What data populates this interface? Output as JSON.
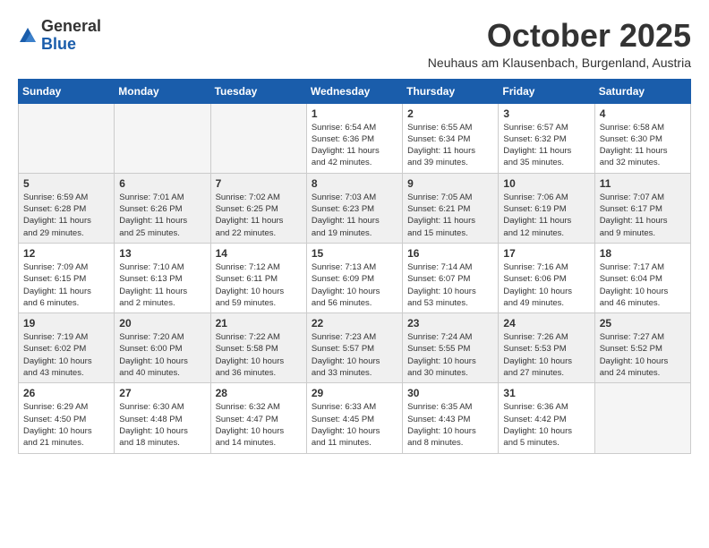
{
  "logo": {
    "general": "General",
    "blue": "Blue"
  },
  "header": {
    "month": "October 2025",
    "location": "Neuhaus am Klausenbach, Burgenland, Austria"
  },
  "weekdays": [
    "Sunday",
    "Monday",
    "Tuesday",
    "Wednesday",
    "Thursday",
    "Friday",
    "Saturday"
  ],
  "weeks": [
    [
      {
        "day": "",
        "info": ""
      },
      {
        "day": "",
        "info": ""
      },
      {
        "day": "",
        "info": ""
      },
      {
        "day": "1",
        "info": "Sunrise: 6:54 AM\nSunset: 6:36 PM\nDaylight: 11 hours\nand 42 minutes."
      },
      {
        "day": "2",
        "info": "Sunrise: 6:55 AM\nSunset: 6:34 PM\nDaylight: 11 hours\nand 39 minutes."
      },
      {
        "day": "3",
        "info": "Sunrise: 6:57 AM\nSunset: 6:32 PM\nDaylight: 11 hours\nand 35 minutes."
      },
      {
        "day": "4",
        "info": "Sunrise: 6:58 AM\nSunset: 6:30 PM\nDaylight: 11 hours\nand 32 minutes."
      }
    ],
    [
      {
        "day": "5",
        "info": "Sunrise: 6:59 AM\nSunset: 6:28 PM\nDaylight: 11 hours\nand 29 minutes."
      },
      {
        "day": "6",
        "info": "Sunrise: 7:01 AM\nSunset: 6:26 PM\nDaylight: 11 hours\nand 25 minutes."
      },
      {
        "day": "7",
        "info": "Sunrise: 7:02 AM\nSunset: 6:25 PM\nDaylight: 11 hours\nand 22 minutes."
      },
      {
        "day": "8",
        "info": "Sunrise: 7:03 AM\nSunset: 6:23 PM\nDaylight: 11 hours\nand 19 minutes."
      },
      {
        "day": "9",
        "info": "Sunrise: 7:05 AM\nSunset: 6:21 PM\nDaylight: 11 hours\nand 15 minutes."
      },
      {
        "day": "10",
        "info": "Sunrise: 7:06 AM\nSunset: 6:19 PM\nDaylight: 11 hours\nand 12 minutes."
      },
      {
        "day": "11",
        "info": "Sunrise: 7:07 AM\nSunset: 6:17 PM\nDaylight: 11 hours\nand 9 minutes."
      }
    ],
    [
      {
        "day": "12",
        "info": "Sunrise: 7:09 AM\nSunset: 6:15 PM\nDaylight: 11 hours\nand 6 minutes."
      },
      {
        "day": "13",
        "info": "Sunrise: 7:10 AM\nSunset: 6:13 PM\nDaylight: 11 hours\nand 2 minutes."
      },
      {
        "day": "14",
        "info": "Sunrise: 7:12 AM\nSunset: 6:11 PM\nDaylight: 10 hours\nand 59 minutes."
      },
      {
        "day": "15",
        "info": "Sunrise: 7:13 AM\nSunset: 6:09 PM\nDaylight: 10 hours\nand 56 minutes."
      },
      {
        "day": "16",
        "info": "Sunrise: 7:14 AM\nSunset: 6:07 PM\nDaylight: 10 hours\nand 53 minutes."
      },
      {
        "day": "17",
        "info": "Sunrise: 7:16 AM\nSunset: 6:06 PM\nDaylight: 10 hours\nand 49 minutes."
      },
      {
        "day": "18",
        "info": "Sunrise: 7:17 AM\nSunset: 6:04 PM\nDaylight: 10 hours\nand 46 minutes."
      }
    ],
    [
      {
        "day": "19",
        "info": "Sunrise: 7:19 AM\nSunset: 6:02 PM\nDaylight: 10 hours\nand 43 minutes."
      },
      {
        "day": "20",
        "info": "Sunrise: 7:20 AM\nSunset: 6:00 PM\nDaylight: 10 hours\nand 40 minutes."
      },
      {
        "day": "21",
        "info": "Sunrise: 7:22 AM\nSunset: 5:58 PM\nDaylight: 10 hours\nand 36 minutes."
      },
      {
        "day": "22",
        "info": "Sunrise: 7:23 AM\nSunset: 5:57 PM\nDaylight: 10 hours\nand 33 minutes."
      },
      {
        "day": "23",
        "info": "Sunrise: 7:24 AM\nSunset: 5:55 PM\nDaylight: 10 hours\nand 30 minutes."
      },
      {
        "day": "24",
        "info": "Sunrise: 7:26 AM\nSunset: 5:53 PM\nDaylight: 10 hours\nand 27 minutes."
      },
      {
        "day": "25",
        "info": "Sunrise: 7:27 AM\nSunset: 5:52 PM\nDaylight: 10 hours\nand 24 minutes."
      }
    ],
    [
      {
        "day": "26",
        "info": "Sunrise: 6:29 AM\nSunset: 4:50 PM\nDaylight: 10 hours\nand 21 minutes."
      },
      {
        "day": "27",
        "info": "Sunrise: 6:30 AM\nSunset: 4:48 PM\nDaylight: 10 hours\nand 18 minutes."
      },
      {
        "day": "28",
        "info": "Sunrise: 6:32 AM\nSunset: 4:47 PM\nDaylight: 10 hours\nand 14 minutes."
      },
      {
        "day": "29",
        "info": "Sunrise: 6:33 AM\nSunset: 4:45 PM\nDaylight: 10 hours\nand 11 minutes."
      },
      {
        "day": "30",
        "info": "Sunrise: 6:35 AM\nSunset: 4:43 PM\nDaylight: 10 hours\nand 8 minutes."
      },
      {
        "day": "31",
        "info": "Sunrise: 6:36 AM\nSunset: 4:42 PM\nDaylight: 10 hours\nand 5 minutes."
      },
      {
        "day": "",
        "info": ""
      }
    ]
  ]
}
